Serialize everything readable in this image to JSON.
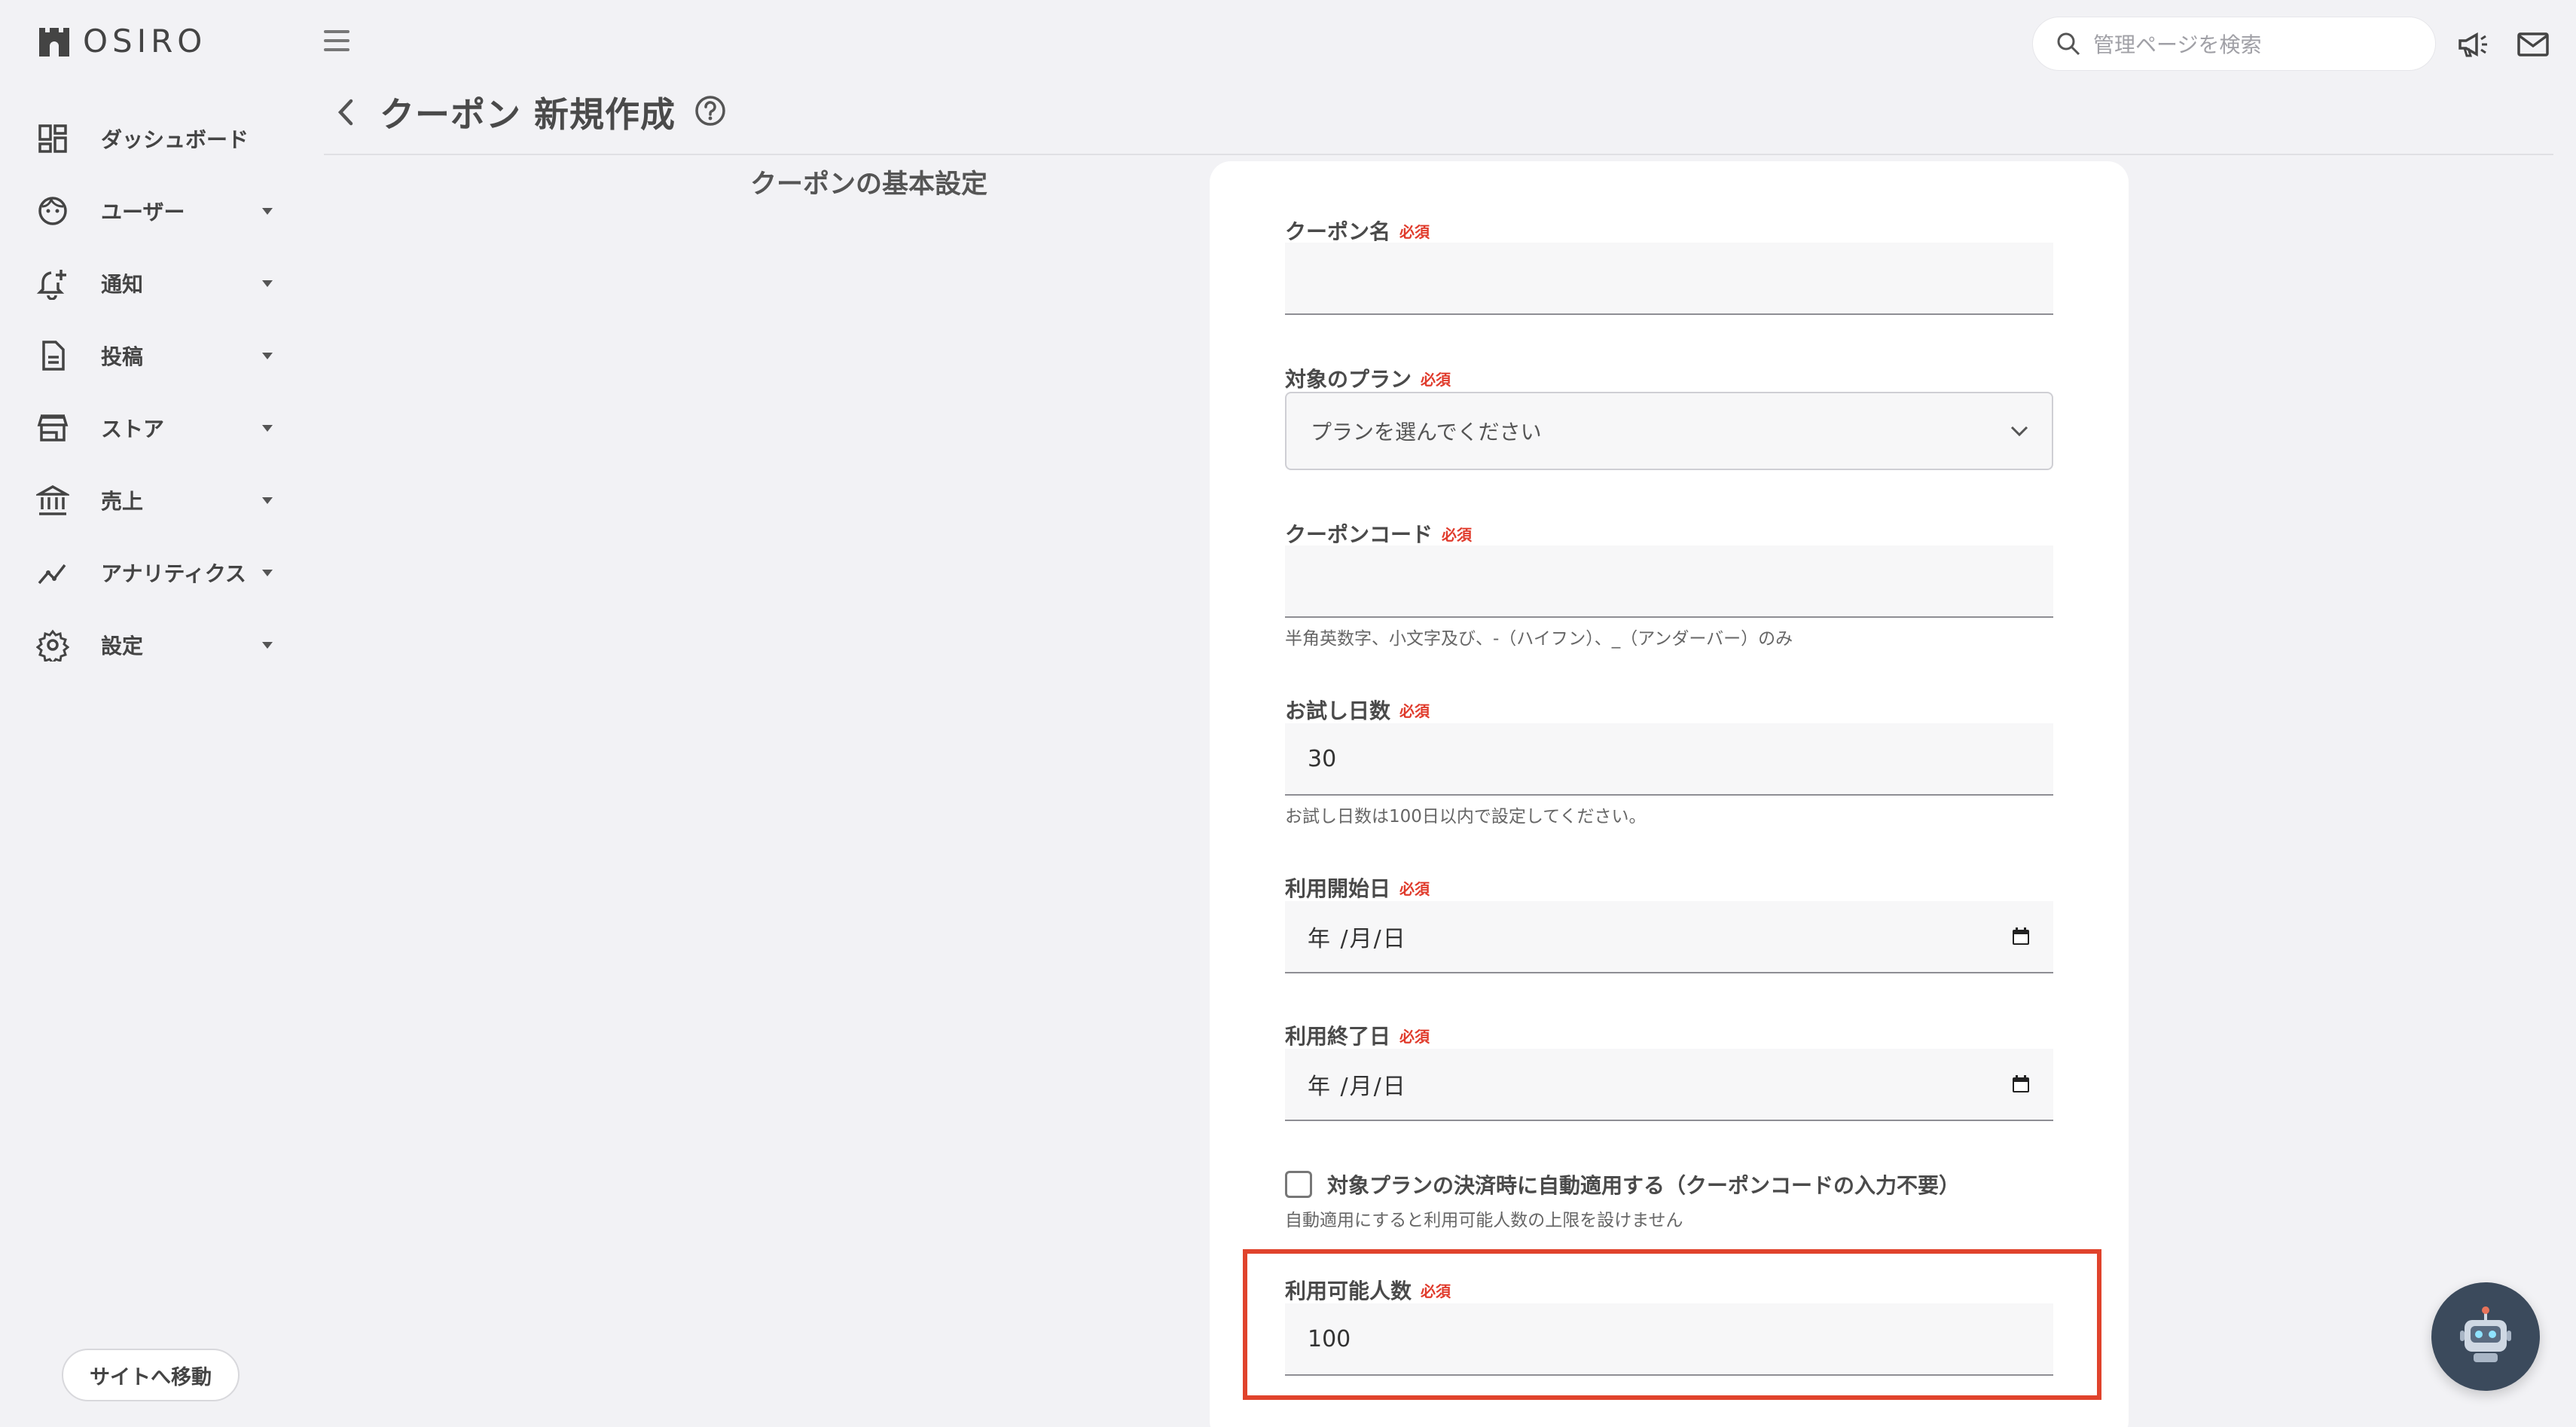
{
  "brand": {
    "name": "OSIRO"
  },
  "sidebar": {
    "items": [
      {
        "label": "ダッシュボード",
        "icon": "dashboard-icon",
        "has_submenu": false
      },
      {
        "label": "ユーザー",
        "icon": "user-face-icon",
        "has_submenu": true
      },
      {
        "label": "通知",
        "icon": "bell-add-icon",
        "has_submenu": true
      },
      {
        "label": "投稿",
        "icon": "document-icon",
        "has_submenu": true
      },
      {
        "label": "ストア",
        "icon": "store-icon",
        "has_submenu": true
      },
      {
        "label": "売上",
        "icon": "bank-icon",
        "has_submenu": true
      },
      {
        "label": "アナリティクス",
        "icon": "analytics-icon",
        "has_submenu": true
      },
      {
        "label": "設定",
        "icon": "gear-icon",
        "has_submenu": true
      }
    ],
    "site_button": "サイトへ移動"
  },
  "header": {
    "search_placeholder": "管理ページを検索"
  },
  "page": {
    "title": "クーポン 新規作成",
    "section_title": "クーポンの基本設定"
  },
  "form": {
    "required_badge": "必須",
    "coupon_name": {
      "label": "クーポン名",
      "value": ""
    },
    "plan": {
      "label": "対象のプラン",
      "selected": "プランを選んでください"
    },
    "coupon_code": {
      "label": "クーポンコード",
      "value": "",
      "hint": "半角英数字、小文字及び、-（ハイフン）、_（アンダーバー）のみ"
    },
    "trial_days": {
      "label": "お試し日数",
      "value": "30",
      "hint": "お試し日数は100日以内で設定してください。"
    },
    "start_date": {
      "label": "利用開始日",
      "value": "年 /月/日"
    },
    "end_date": {
      "label": "利用終了日",
      "value": "年 /月/日"
    },
    "auto_apply": {
      "label": "対象プランの決済時に自動適用する（クーポンコードの入力不要）",
      "hint": "自動適用にすると利用可能人数の上限を設けません",
      "checked": false
    },
    "max_users": {
      "label": "利用可能人数",
      "value": "100"
    }
  },
  "colors": {
    "required": "#e03b2c",
    "highlight": "#e0432c",
    "background": "#f2f2f5"
  }
}
